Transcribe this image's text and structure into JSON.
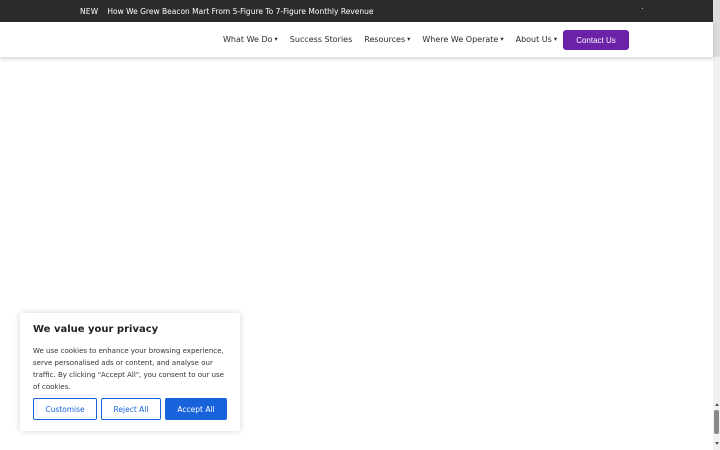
{
  "announcement": {
    "badge": "NEW",
    "text": "How We Grew Beacon Mart From 5-Figure To 7-Figure Monthly Revenue"
  },
  "nav": {
    "items": [
      {
        "label": "What We Do",
        "dropdown": true
      },
      {
        "label": "Success Stories",
        "dropdown": false
      },
      {
        "label": "Resources",
        "dropdown": true
      },
      {
        "label": "Where We Operate",
        "dropdown": true
      },
      {
        "label": "About Us",
        "dropdown": true
      }
    ],
    "contact_label": "Contact Us",
    "chevron_glyph": "⌄"
  },
  "cookie": {
    "title": "We value your privacy",
    "body": "We use cookies to enhance your browsing experience, serve personalised ads or content, and analyse our traffic. By clicking \"Accept All\", you consent to our use of cookies.",
    "customise_label": "Customise",
    "reject_label": "Reject All",
    "accept_label": "Accept All"
  },
  "colors": {
    "topbar_bg": "#2b2b2b",
    "contact_bg": "#6b21a8",
    "cookie_accent": "#1863dc"
  }
}
